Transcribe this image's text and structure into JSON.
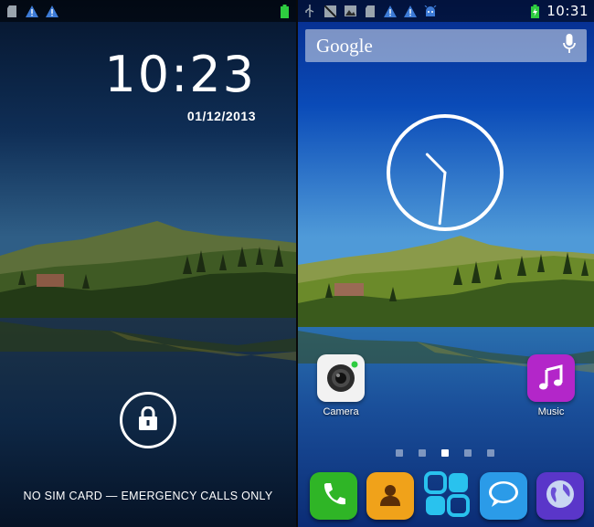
{
  "lock_screen": {
    "time": "10:23",
    "date": "01/12/2013",
    "footer": "NO SIM CARD — EMERGENCY CALLS ONLY",
    "status_icons": [
      "sdcard-icon",
      "warning-icon",
      "warning-icon",
      "battery-icon"
    ]
  },
  "home_screen": {
    "status_time": "10:31",
    "status_icons": [
      "usb-icon",
      "screenshot-icon",
      "image-icon",
      "sdcard-icon",
      "warning-icon",
      "warning-icon",
      "android-debug-icon",
      "battery-charging-icon"
    ],
    "search": {
      "label": "Google"
    },
    "clock_widget": {
      "hour": 10,
      "minute": 31
    },
    "apps": [
      {
        "label": "Camera",
        "icon": "camera-icon"
      },
      {
        "label": "Music",
        "icon": "music-icon"
      }
    ],
    "pages": {
      "count": 5,
      "active": 3
    },
    "dock": [
      {
        "name": "phone",
        "icon": "phone-icon"
      },
      {
        "name": "contacts",
        "icon": "contacts-icon"
      },
      {
        "name": "app-drawer",
        "icon": "apps-grid-icon"
      },
      {
        "name": "messaging",
        "icon": "message-icon"
      },
      {
        "name": "browser",
        "icon": "globe-icon"
      }
    ]
  },
  "colors": {
    "warning": "#3d7bd6",
    "battery": "#2ecc40",
    "music": "#b326c9",
    "phone": "#2fb526",
    "contacts": "#f0a21a",
    "apps": "#29c2ee",
    "message": "#2b9be8",
    "browser": "#5a36c9"
  }
}
